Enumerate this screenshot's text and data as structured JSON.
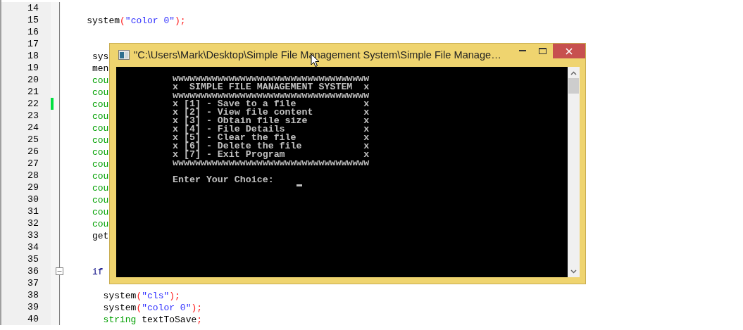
{
  "editor": {
    "lines": [
      {
        "number": "14"
      },
      {
        "number": "15",
        "tokens": [
          {
            "kind": "plain",
            "text": "    system"
          },
          {
            "kind": "operator",
            "text": "("
          },
          {
            "kind": "string",
            "text": "\"color 0\""
          },
          {
            "kind": "operator",
            "text": ");"
          }
        ]
      },
      {
        "number": "16"
      },
      {
        "number": "17"
      },
      {
        "number": "18",
        "tokens": [
          {
            "kind": "plain",
            "text": "     sys"
          }
        ]
      },
      {
        "number": "19",
        "tokens": [
          {
            "kind": "plain",
            "text": "     men"
          }
        ]
      },
      {
        "number": "20",
        "tokens": [
          {
            "kind": "type",
            "text": "     cou"
          }
        ]
      },
      {
        "number": "21",
        "tokens": [
          {
            "kind": "type",
            "text": "     cou"
          }
        ]
      },
      {
        "number": "22",
        "changed": true,
        "tokens": [
          {
            "kind": "type",
            "text": "     cou"
          }
        ]
      },
      {
        "number": "23",
        "tokens": [
          {
            "kind": "type",
            "text": "     cou"
          }
        ]
      },
      {
        "number": "24",
        "tokens": [
          {
            "kind": "type",
            "text": "     cou"
          }
        ]
      },
      {
        "number": "25",
        "tokens": [
          {
            "kind": "type",
            "text": "     cou"
          }
        ]
      },
      {
        "number": "26",
        "tokens": [
          {
            "kind": "type",
            "text": "     cou"
          }
        ]
      },
      {
        "number": "27",
        "tokens": [
          {
            "kind": "type",
            "text": "     cou"
          }
        ]
      },
      {
        "number": "28",
        "tokens": [
          {
            "kind": "type",
            "text": "     cou"
          }
        ]
      },
      {
        "number": "29",
        "tokens": [
          {
            "kind": "type",
            "text": "     cou"
          }
        ]
      },
      {
        "number": "30",
        "tokens": [
          {
            "kind": "type",
            "text": "     cou"
          }
        ]
      },
      {
        "number": "31",
        "tokens": [
          {
            "kind": "type",
            "text": "     cou"
          }
        ]
      },
      {
        "number": "32",
        "tokens": [
          {
            "kind": "type",
            "text": "     cou"
          }
        ]
      },
      {
        "number": "33",
        "tokens": [
          {
            "kind": "plain",
            "text": "     get"
          }
        ]
      },
      {
        "number": "34"
      },
      {
        "number": "35"
      },
      {
        "number": "36",
        "expanded": true,
        "tokens": [
          {
            "kind": "keyword",
            "text": "     if"
          }
        ]
      },
      {
        "number": "37"
      },
      {
        "number": "38",
        "tokens": [
          {
            "kind": "plain",
            "text": "       system"
          },
          {
            "kind": "operator",
            "text": "("
          },
          {
            "kind": "string",
            "text": "\"cls\""
          },
          {
            "kind": "operator",
            "text": ");"
          }
        ]
      },
      {
        "number": "39",
        "tokens": [
          {
            "kind": "plain",
            "text": "       system"
          },
          {
            "kind": "operator",
            "text": "("
          },
          {
            "kind": "string",
            "text": "\"color 0\""
          },
          {
            "kind": "operator",
            "text": ");"
          }
        ]
      },
      {
        "number": "40",
        "tokens": [
          {
            "kind": "type",
            "text": "       string"
          },
          {
            "kind": "plain",
            "text": " textToSave"
          },
          {
            "kind": "operator",
            "text": ";"
          }
        ]
      }
    ]
  },
  "console_window": {
    "title": "\"C:\\Users\\Mark\\Desktop\\Simple File Management System\\Simple File Manage…",
    "lines": [
      "wwwwwwwwwwwwwwwwwwwwwwwwwwwwwwwwwww",
      "x  SIMPLE FILE MANAGEMENT SYSTEM  x",
      "wwwwwwwwwwwwwwwwwwwwwwwwwwwwwwwwwww",
      "x [1] - Save to a file            x",
      "x [2] - View file content         x",
      "x [3] - Obtain file size          x",
      "x [4] - File Details              x",
      "x [5] - Clear the file            x",
      "x [6] - Delete the file           x",
      "x [7] - Exit Program              x",
      "wwwwwwwwwwwwwwwwwwwwwwwwwwwwwwwwwww"
    ],
    "prompt": "Enter Your Choice:"
  }
}
